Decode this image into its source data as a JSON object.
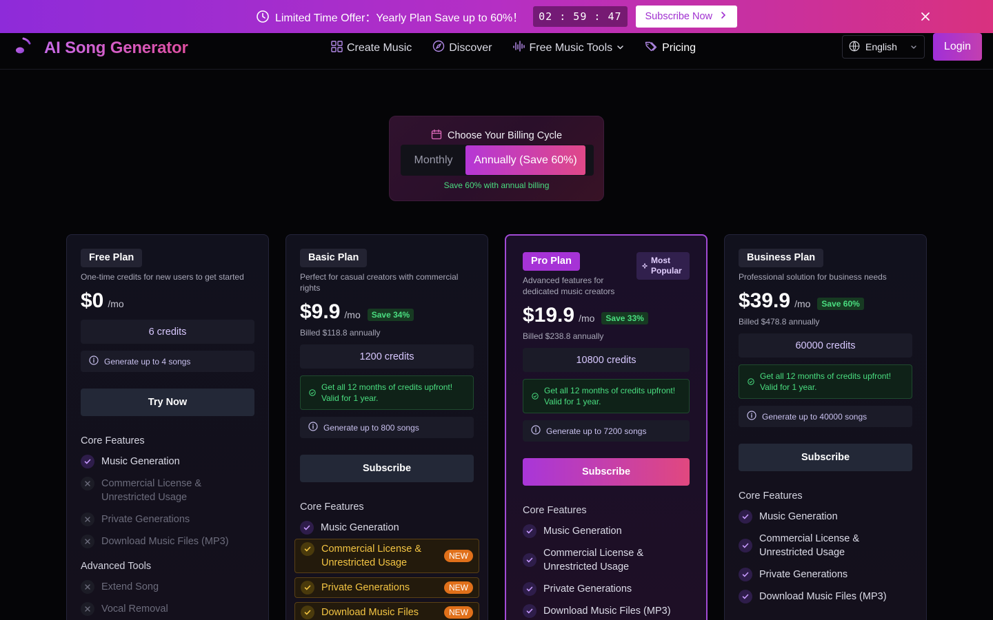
{
  "promo": {
    "offer_text": "Limited Time Offer：Yearly Plan Save up to 60%！",
    "timer": "02 : 59 : 47",
    "cta": "Subscribe Now"
  },
  "header": {
    "brand": "AI Song Generator",
    "nav": {
      "create": "Create Music",
      "discover": "Discover",
      "tools": "Free Music Tools",
      "pricing": "Pricing"
    },
    "language": "English",
    "login": "Login"
  },
  "billing": {
    "title": "Choose Your Billing Cycle",
    "monthly": "Monthly",
    "annual": "Annually (Save 60%)",
    "note": "Save 60% with annual billing"
  },
  "plans": {
    "free": {
      "name": "Free Plan",
      "desc": "One-time credits for new users to get started",
      "price": "$0",
      "per": "/mo",
      "credits": "6 credits",
      "songs": "Generate up to 4 songs",
      "cta": "Try Now",
      "core_title": "Core Features",
      "core": [
        "Music Generation",
        "Commercial License & Unrestricted Usage",
        "Private Generations",
        "Download Music Files (MP3)"
      ],
      "adv_title": "Advanced Tools",
      "adv": [
        "Extend Song",
        "Vocal Removal"
      ]
    },
    "basic": {
      "name": "Basic Plan",
      "desc": "Perfect for casual creators with commercial rights",
      "price": "$9.9",
      "per": "/mo",
      "save": "Save 34%",
      "billed": "Billed $118.8 annually",
      "credits": "1200 credits",
      "upfront": "Get all 12 months of credits upfront! Valid for 1 year.",
      "songs": "Generate up to 800 songs",
      "cta": "Subscribe",
      "core_title": "Core Features",
      "core": [
        "Music Generation",
        "Commercial License & Unrestricted Usage",
        "Private Generations",
        "Download Music Files"
      ],
      "new_label": "NEW"
    },
    "pro": {
      "name": "Pro Plan",
      "popular": "Most Popular",
      "desc": "Advanced features for dedicated music creators",
      "price": "$19.9",
      "per": "/mo",
      "save": "Save 33%",
      "billed": "Billed $238.8 annually",
      "credits": "10800 credits",
      "upfront": "Get all 12 months of credits upfront! Valid for 1 year.",
      "songs": "Generate up to 7200 songs",
      "cta": "Subscribe",
      "core_title": "Core Features",
      "core": [
        "Music Generation",
        "Commercial License & Unrestricted Usage",
        "Private Generations",
        "Download Music Files (MP3)"
      ]
    },
    "business": {
      "name": "Business Plan",
      "desc": "Professional solution for business needs",
      "price": "$39.9",
      "per": "/mo",
      "save": "Save 60%",
      "billed": "Billed $478.8 annually",
      "credits": "60000 credits",
      "upfront": "Get all 12 months of credits upfront! Valid for 1 year.",
      "songs": "Generate up to 40000 songs",
      "cta": "Subscribe",
      "core_title": "Core Features",
      "core": [
        "Music Generation",
        "Commercial License & Unrestricted Usage",
        "Private Generations",
        "Download Music Files (MP3)"
      ]
    }
  },
  "colors": {
    "accent": "#a836d9",
    "accent2": "#e1487f",
    "green": "#4ade80",
    "new_badge": "#e0701a"
  }
}
